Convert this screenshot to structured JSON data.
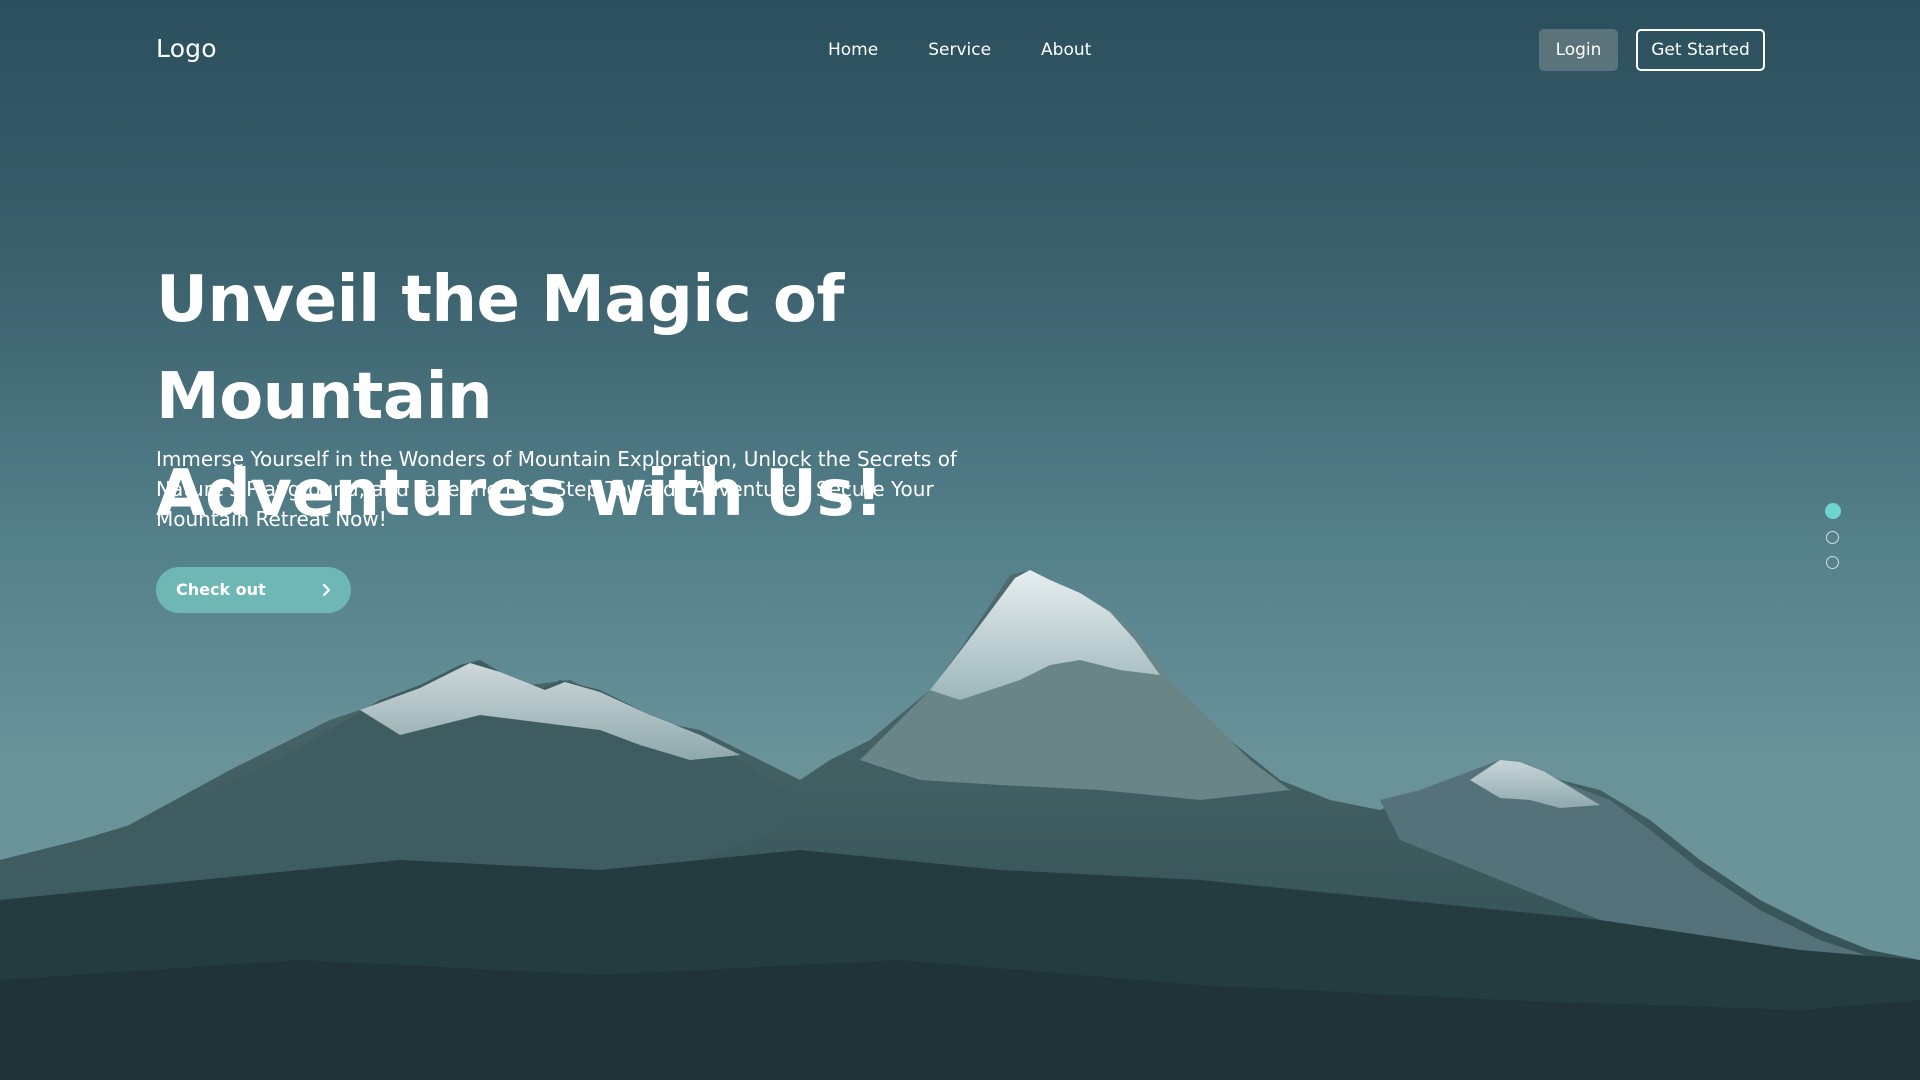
{
  "header": {
    "logo": "Logo",
    "nav": [
      {
        "label": "Home"
      },
      {
        "label": "Service"
      },
      {
        "label": "About"
      }
    ],
    "login_label": "Login",
    "get_started_label": "Get Started"
  },
  "hero": {
    "headline_line1": "Unveil the Magic of Mountain",
    "headline_line2": "Adventures with Us!",
    "subtitle": "Immerse Yourself in the Wonders of Mountain Exploration, Unlock the Secrets of Nature's Playground, and Take the First Step Towards Adventure - Secure Your Mountain Retreat Now!",
    "cta_label": "Check out",
    "cta_icon": "chevron-right-icon"
  },
  "slider": {
    "slide_count": 3,
    "active_index": 0
  },
  "colors": {
    "sky_top": "#2b4f5d",
    "sky_bottom": "#6c969b",
    "accent": "#6fb7b4",
    "active_dot": "#6fd3cf",
    "login_bg": "#5b747c"
  }
}
